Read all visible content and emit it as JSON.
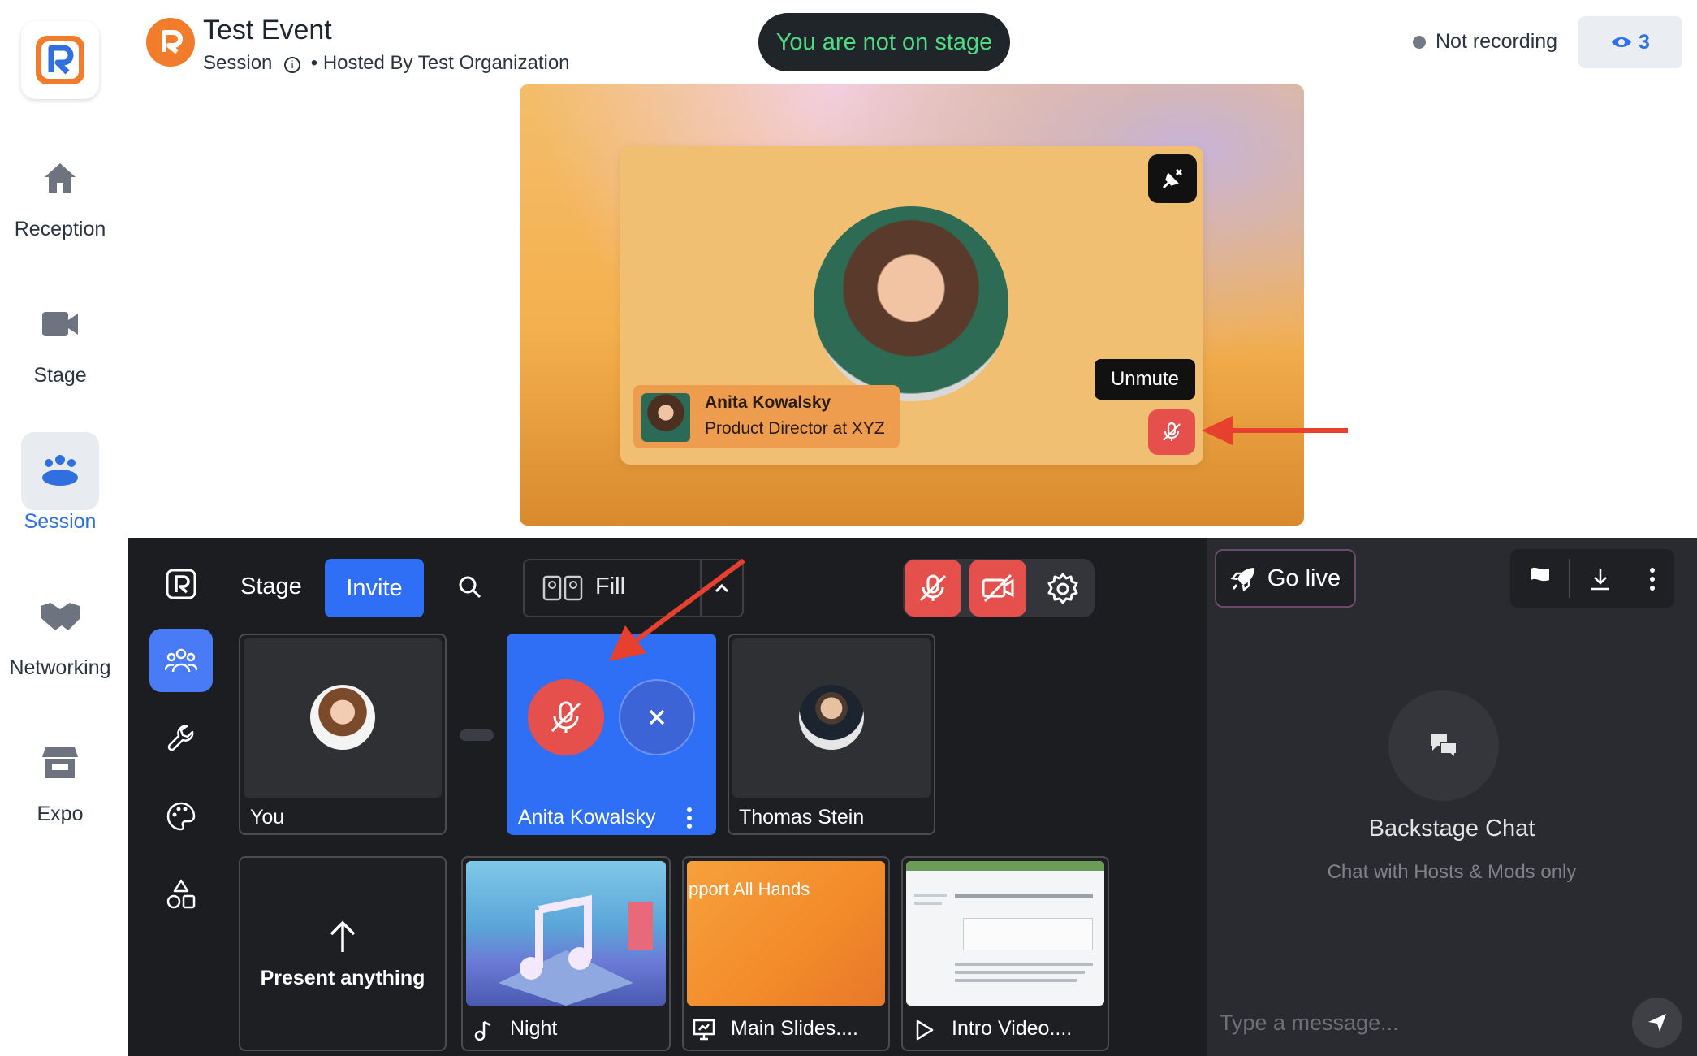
{
  "sidebar": {
    "items": [
      {
        "label": "Reception",
        "icon": "home-icon"
      },
      {
        "label": "Stage",
        "icon": "video-camera-icon"
      },
      {
        "label": "Session",
        "icon": "people-group-icon",
        "active": true
      },
      {
        "label": "Networking",
        "icon": "handshake-icon"
      },
      {
        "label": "Expo",
        "icon": "store-icon"
      }
    ]
  },
  "header": {
    "title": "Test Event",
    "session_label": "Session",
    "hosted_prefix": "Hosted By",
    "organization": "Test Organization",
    "stage_status": "You are not on stage",
    "recording_status": "Not recording",
    "viewer_count": "3"
  },
  "stage": {
    "speaker_name": "Anita Kowalsky",
    "speaker_role": "Product Director at XYZ",
    "tooltip": "Unmute"
  },
  "backstage": {
    "stage_label": "Stage",
    "invite_label": "Invite",
    "layout_label": "Fill",
    "participants": [
      {
        "name": "You"
      },
      {
        "name": "Anita Kowalsky"
      },
      {
        "name": "Thomas Stein"
      }
    ],
    "media": [
      {
        "label": "Present anything"
      },
      {
        "label": "Night"
      },
      {
        "label": "Main Slides...."
      },
      {
        "label": "Intro Video...."
      }
    ],
    "slide_text": "pport All Hands"
  },
  "chat": {
    "go_live": "Go live",
    "title": "Backstage Chat",
    "subtitle": "Chat with Hosts & Mods only",
    "placeholder": "Type a message..."
  },
  "colors": {
    "accent_blue": "#2f6ff5",
    "mute_red": "#e5504d",
    "stage_green": "#4fdc84",
    "brand_orange": "#f07c2c"
  }
}
